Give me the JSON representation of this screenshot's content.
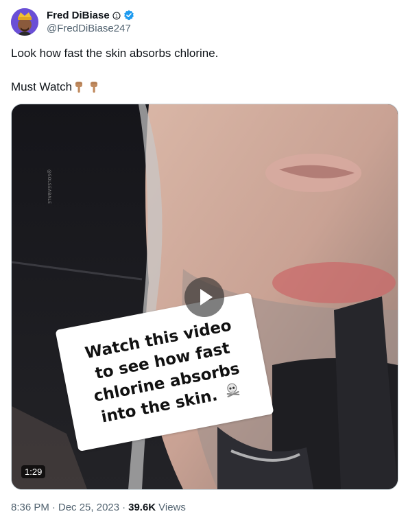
{
  "author": {
    "display_name": "Fred DiBiase",
    "handle": "@FredDiBiase247"
  },
  "tweet": {
    "line1": "Look how fast the skin absorbs chlorine.",
    "line2": "Must Watch",
    "emoji_icons": [
      "pointing-down-hand-icon",
      "pointing-down-hand-icon"
    ]
  },
  "media": {
    "duration": "1:29",
    "watermark": "@SOLSEABALE",
    "caption_lines": [
      "Watch this video",
      "to see how fast",
      "chlorine absorbs",
      "into the skin."
    ],
    "caption_icon": "skull-crossbones-icon"
  },
  "meta": {
    "time": "8:36 PM",
    "separator": "·",
    "date": "Dec 25, 2023",
    "views_count": "39.6K",
    "views_label": "Views"
  },
  "colors": {
    "verified_blue": "#1d9bf0",
    "secondary_text": "#536471",
    "primary_text": "#0f1419"
  }
}
